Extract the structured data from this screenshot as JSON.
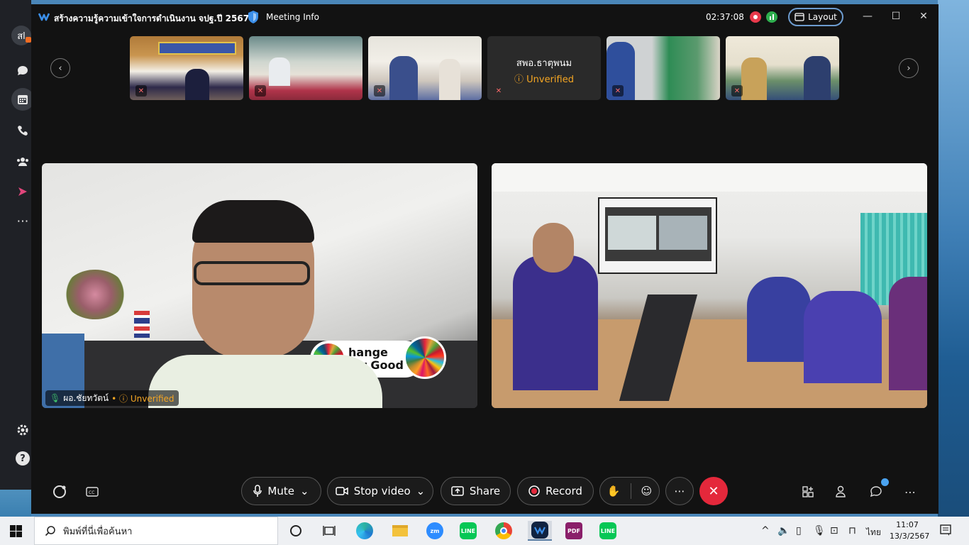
{
  "rail": {
    "avatar_initials": "สl",
    "icons": [
      "chat-icon",
      "calendar-icon",
      "phone-icon",
      "people-icon",
      "apps-icon",
      "more-icon",
      "settings-icon",
      "help-icon"
    ]
  },
  "window": {
    "title": "สร้างความรู้ความเข้าใจการดำเนินงาน จปฐ.ปี 2567",
    "meeting_info_label": "Meeting Info",
    "elapsed_time": "02:37:08",
    "layout_label": "Layout"
  },
  "thumbnails": [
    {
      "name": "",
      "muted": true,
      "has_video": true
    },
    {
      "name": "",
      "muted": true,
      "has_video": true
    },
    {
      "name": "",
      "muted": true,
      "has_video": true
    },
    {
      "name": "สพอ.ธาตุพนม",
      "status": "Unverified",
      "muted": true,
      "has_video": false
    },
    {
      "name": "",
      "muted": true,
      "has_video": true
    },
    {
      "name": "",
      "muted": true,
      "has_video": true
    }
  ],
  "main_videos": [
    {
      "name": "ผอ.ชัยทวัตน์",
      "status": "Unverified",
      "sign_text_line1": "hange",
      "sign_text_line2": "for Good"
    },
    {
      "name": ""
    }
  ],
  "controls": {
    "mute_label": "Mute",
    "stop_video_label": "Stop video",
    "share_label": "Share",
    "record_label": "Record"
  },
  "taskbar": {
    "search_placeholder": "พิมพ์ที่นี่เพื่อค้นหา",
    "language": "ไทย",
    "time": "11:07",
    "date": "13/3/2567",
    "apps": [
      "zm",
      "LINE",
      "PDF",
      "LINE"
    ]
  },
  "colors": {
    "window_bg": "#121212",
    "end_call": "#e4283b",
    "unverified": "#f5a623",
    "accent_blue": "#4aa3f0"
  }
}
